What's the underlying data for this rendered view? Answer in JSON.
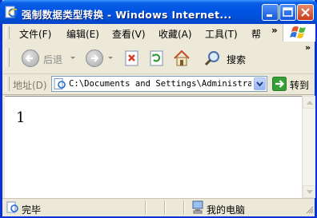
{
  "window": {
    "title": "强制数据类型转换 - Windows Internet..."
  },
  "menu": {
    "items": [
      "文件(F)",
      "编辑(E)",
      "查看(V)",
      "收藏(A)",
      "工具(T)",
      "帮"
    ],
    "overflow": "»"
  },
  "toolbar": {
    "back_label": "后退",
    "search_label": "搜索",
    "overflow": "»"
  },
  "address": {
    "label": "地址(D)",
    "url": "C:\\Documents and Settings\\Administrato",
    "go_label": "转到"
  },
  "page": {
    "body_text": "1"
  },
  "status": {
    "text": "完毕",
    "zone": "我的电脑"
  },
  "colors": {
    "titlebar": "#0054e3",
    "close_button": "#c83c1a",
    "go_green": "#2f9a2f",
    "window_face": "#ece9d8"
  }
}
